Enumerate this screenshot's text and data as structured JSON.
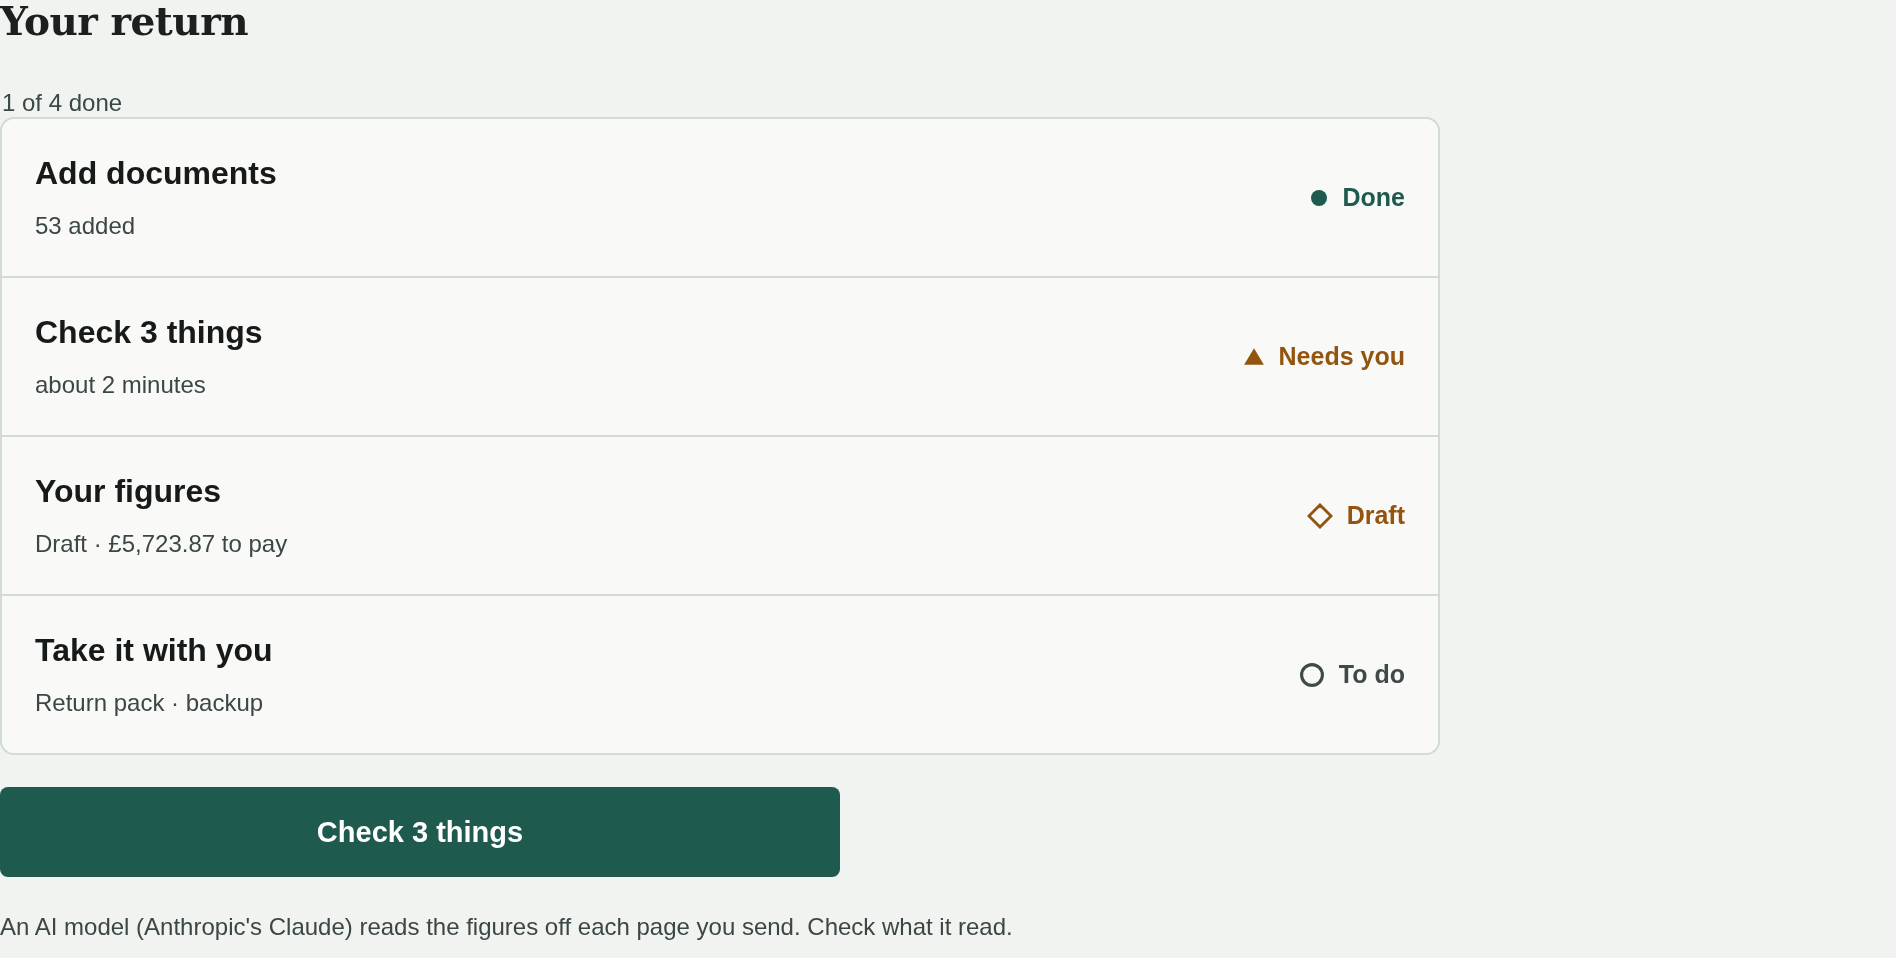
{
  "page": {
    "title": "Your return",
    "progress": "1 of 4 done"
  },
  "steps": [
    {
      "title": "Add documents",
      "detail": "53 added",
      "status": {
        "kind": "done",
        "label": "Done"
      }
    },
    {
      "title": "Check 3 things",
      "detail": "about 2 minutes",
      "status": {
        "kind": "needs",
        "label": "Needs you"
      }
    },
    {
      "title": "Your figures",
      "detail": "Draft · £5,723.87 to pay",
      "status": {
        "kind": "draft",
        "label": "Draft"
      }
    },
    {
      "title": "Take it with you",
      "detail": "Return pack · backup",
      "status": {
        "kind": "todo",
        "label": "To do"
      }
    }
  ],
  "primary_button": "Check 3 things",
  "footnote": "An AI model (Anthropic's Claude) reads the figures off each page you send. Check what it read."
}
